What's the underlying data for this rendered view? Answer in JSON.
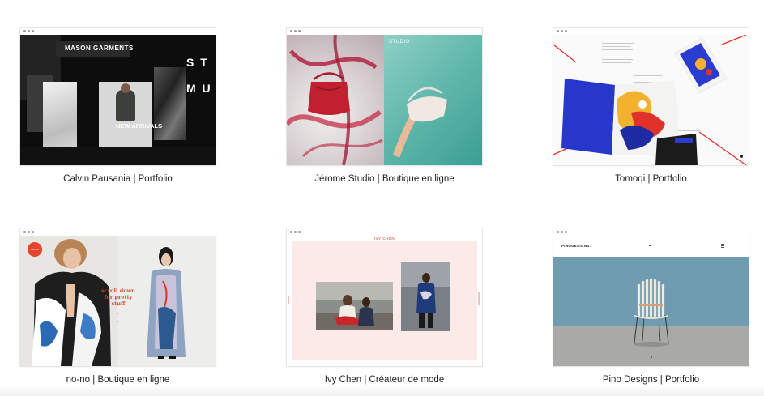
{
  "templates": [
    {
      "caption": "Calvin Pausania | Portfolio",
      "preview": {
        "headline": "MASON GARMENTS",
        "side_text_1": "S T",
        "side_text_2": "M U",
        "new_label": "NEW ARRIVALS"
      }
    },
    {
      "caption": "Jérome Studio | Boutique en ligne",
      "preview": {
        "label": "STUDIO"
      }
    },
    {
      "caption": "Tomoqi | Portfolio",
      "preview": {}
    },
    {
      "caption": "no-no | Boutique en ligne",
      "preview": {
        "scroll_text": "scroll down for pretty stuff",
        "badge": "no-no"
      }
    },
    {
      "caption": "Ivy Chen | Créateur de mode",
      "preview": {
        "name": "IVY CHEN"
      }
    },
    {
      "caption": "Pino Designs | Portfolio",
      "preview": {
        "logo": "PINODESIGNS."
      }
    }
  ],
  "colors": {
    "page_bg": "#ffffff",
    "caption_text": "#222222",
    "accent_red": "#e2452a"
  }
}
